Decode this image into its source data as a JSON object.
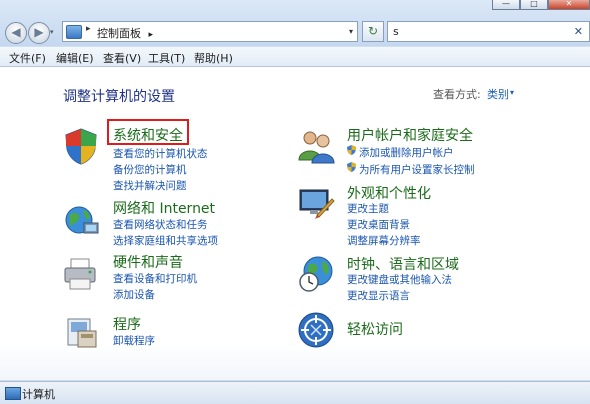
{
  "window": {
    "minimize_glyph": "—",
    "maximize_glyph": "□",
    "close_glyph": "✕"
  },
  "nav": {
    "back_glyph": "◀",
    "forward_glyph": "▶",
    "history_glyph": "▾"
  },
  "address": {
    "separator": "▸",
    "path": "控制面板",
    "separator2": "▸",
    "dropdown_glyph": "▾"
  },
  "refresh_glyph": "↻",
  "search": {
    "value": "s",
    "clear_glyph": "✕"
  },
  "menu": [
    "文件(F)",
    "编辑(E)",
    "查看(V)",
    "工具(T)",
    "帮助(H)"
  ],
  "main": {
    "heading": "调整计算机的设置",
    "view_by_label": "查看方式:",
    "view_by_value": "类别",
    "view_by_arrow": "▾"
  },
  "categories": [
    {
      "title": "系统和安全",
      "links": [
        "查看您的计算机状态",
        "备份您的计算机",
        "查找并解决问题"
      ]
    },
    {
      "title": "网络和 Internet",
      "links": [
        "查看网络状态和任务",
        "选择家庭组和共享选项"
      ]
    },
    {
      "title": "硬件和声音",
      "links": [
        "查看设备和打印机",
        "添加设备"
      ]
    },
    {
      "title": "程序",
      "links": [
        "卸载程序"
      ]
    },
    {
      "title": "用户帐户和家庭安全",
      "links": [
        "添加或删除用户帐户",
        "为所有用户设置家长控制"
      ]
    },
    {
      "title": "外观和个性化",
      "links": [
        "更改主题",
        "更改桌面背景",
        "调整屏幕分辨率"
      ]
    },
    {
      "title": "时钟、语言和区域",
      "links": [
        "更改键盘或其他输入法",
        "更改显示语言"
      ]
    },
    {
      "title": "轻松访问",
      "links": []
    }
  ],
  "status": {
    "text": "计算机"
  },
  "colors": {
    "title_green": "#1a6b1a",
    "link_blue": "#1a55b0",
    "heading_blue": "#1e3287",
    "highlight_red": "#e01b1b"
  }
}
